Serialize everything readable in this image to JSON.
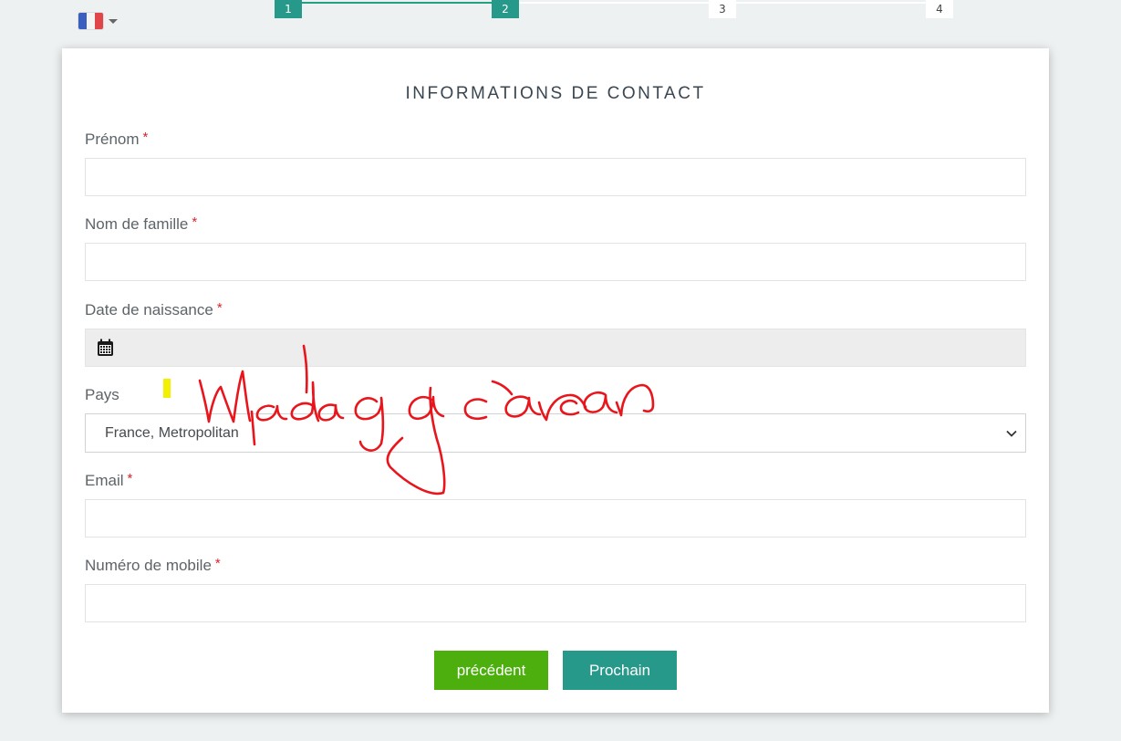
{
  "language": {
    "current": "French",
    "flag_icon": "france-flag-icon",
    "colors": {
      "blue": "#3b5fbf",
      "white": "#f4f4f4",
      "red": "#e0454a"
    }
  },
  "stepper": {
    "steps": [
      "1",
      "2",
      "3",
      "4"
    ],
    "current_step": 2,
    "accent_color": "#26998a"
  },
  "form": {
    "title": "INFORMATIONS DE CONTACT",
    "required_mark": "*",
    "fields": {
      "first_name": {
        "label": "Prénom",
        "value": ""
      },
      "last_name": {
        "label": "Nom de famille",
        "value": ""
      },
      "birth_date": {
        "label": "Date de naissance",
        "value": "",
        "icon": "calendar-icon"
      },
      "country": {
        "label": "Pays",
        "selected": "France, Metropolitan"
      },
      "email": {
        "label": "Email",
        "value": ""
      },
      "mobile": {
        "label": "Numéro de mobile",
        "value": ""
      }
    }
  },
  "buttons": {
    "previous": {
      "label": "précédent",
      "color": "#4caf0d"
    },
    "next": {
      "label": "Prochain",
      "color": "#26998a"
    }
  },
  "annotation": {
    "handwriting": "Madagascar",
    "ink_color": "#e8161c",
    "highlight_color": "#f2f000"
  }
}
